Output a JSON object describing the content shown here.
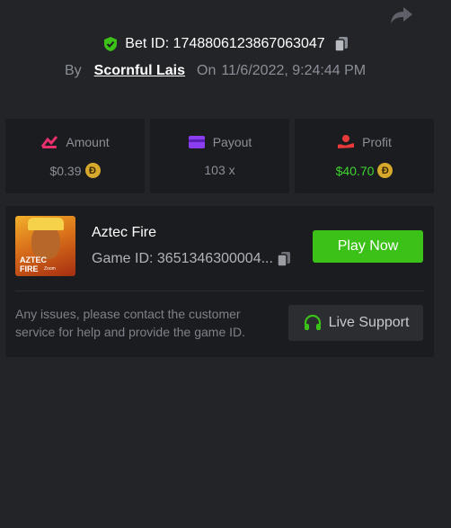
{
  "header": {
    "bet_id_label": "Bet ID: 1748806123867063047",
    "by_label": "By",
    "username": "Scornful Lais",
    "on_label": "On",
    "timestamp": "11/6/2022, 9:24:44 PM"
  },
  "stats": {
    "amount": {
      "label": "Amount",
      "value": "$0.39"
    },
    "payout": {
      "label": "Payout",
      "value": "103 x"
    },
    "profit": {
      "label": "Profit",
      "value": "$40.70"
    },
    "coin_symbol": "Đ"
  },
  "game": {
    "title": "Aztec Fire",
    "game_id": "Game ID: 3651346300004...",
    "thumb_line1": "AZTEC",
    "thumb_line2": "FIRE",
    "thumb_line3": "Zoom",
    "play_label": "Play Now"
  },
  "support": {
    "text": "Any issues, please contact the customer service for help and provide the game ID.",
    "button_label": "Live Support"
  },
  "colors": {
    "background": "#232428",
    "card": "#1b1c20",
    "accent_green": "#3bc117",
    "profit_green": "#3dd42e",
    "coin_gold": "#d6a82c"
  },
  "icons": [
    "share-icon",
    "shield-check-icon",
    "copy-icon",
    "amount-icon",
    "payout-card-icon",
    "profit-icon",
    "coin-icon",
    "headset-icon"
  ]
}
